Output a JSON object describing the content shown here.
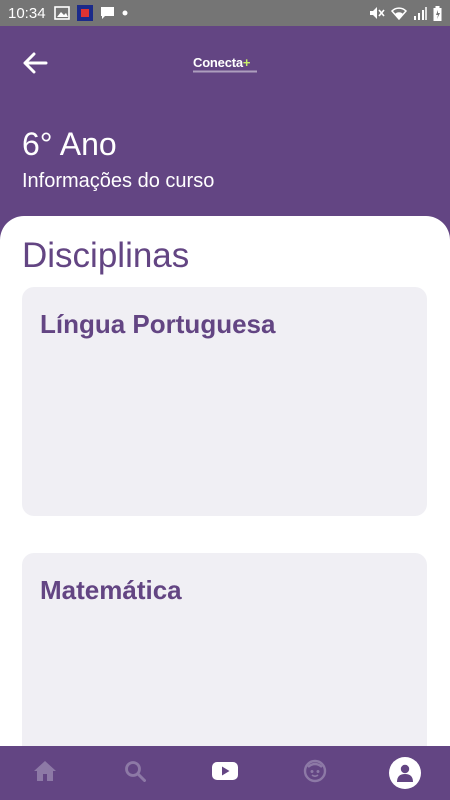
{
  "status_bar": {
    "time": "10:34",
    "left_icons": [
      "image-icon",
      "app-icon",
      "message-icon",
      "dot-icon"
    ],
    "right_icons": [
      "mute-icon",
      "wifi-icon",
      "signal-icon",
      "battery-icon"
    ]
  },
  "header": {
    "back_icon": "arrow-left-icon",
    "logo_text": "Conecta",
    "logo_plus": "+",
    "title": "6° Ano",
    "subtitle": "Informações do curso"
  },
  "main": {
    "section_title": "Disciplinas",
    "subjects": [
      {
        "name": "Língua Portuguesa"
      },
      {
        "name": "Matemática"
      }
    ]
  },
  "bottom_nav": {
    "items": [
      {
        "icon": "home-icon"
      },
      {
        "icon": "search-icon"
      },
      {
        "icon": "video-play-icon"
      },
      {
        "icon": "child-face-icon"
      },
      {
        "icon": "profile-icon"
      }
    ]
  },
  "colors": {
    "primary": "#634583",
    "card_bg": "#f0eff4",
    "status_bar": "#757575",
    "logo_accent": "#c9f06a"
  }
}
